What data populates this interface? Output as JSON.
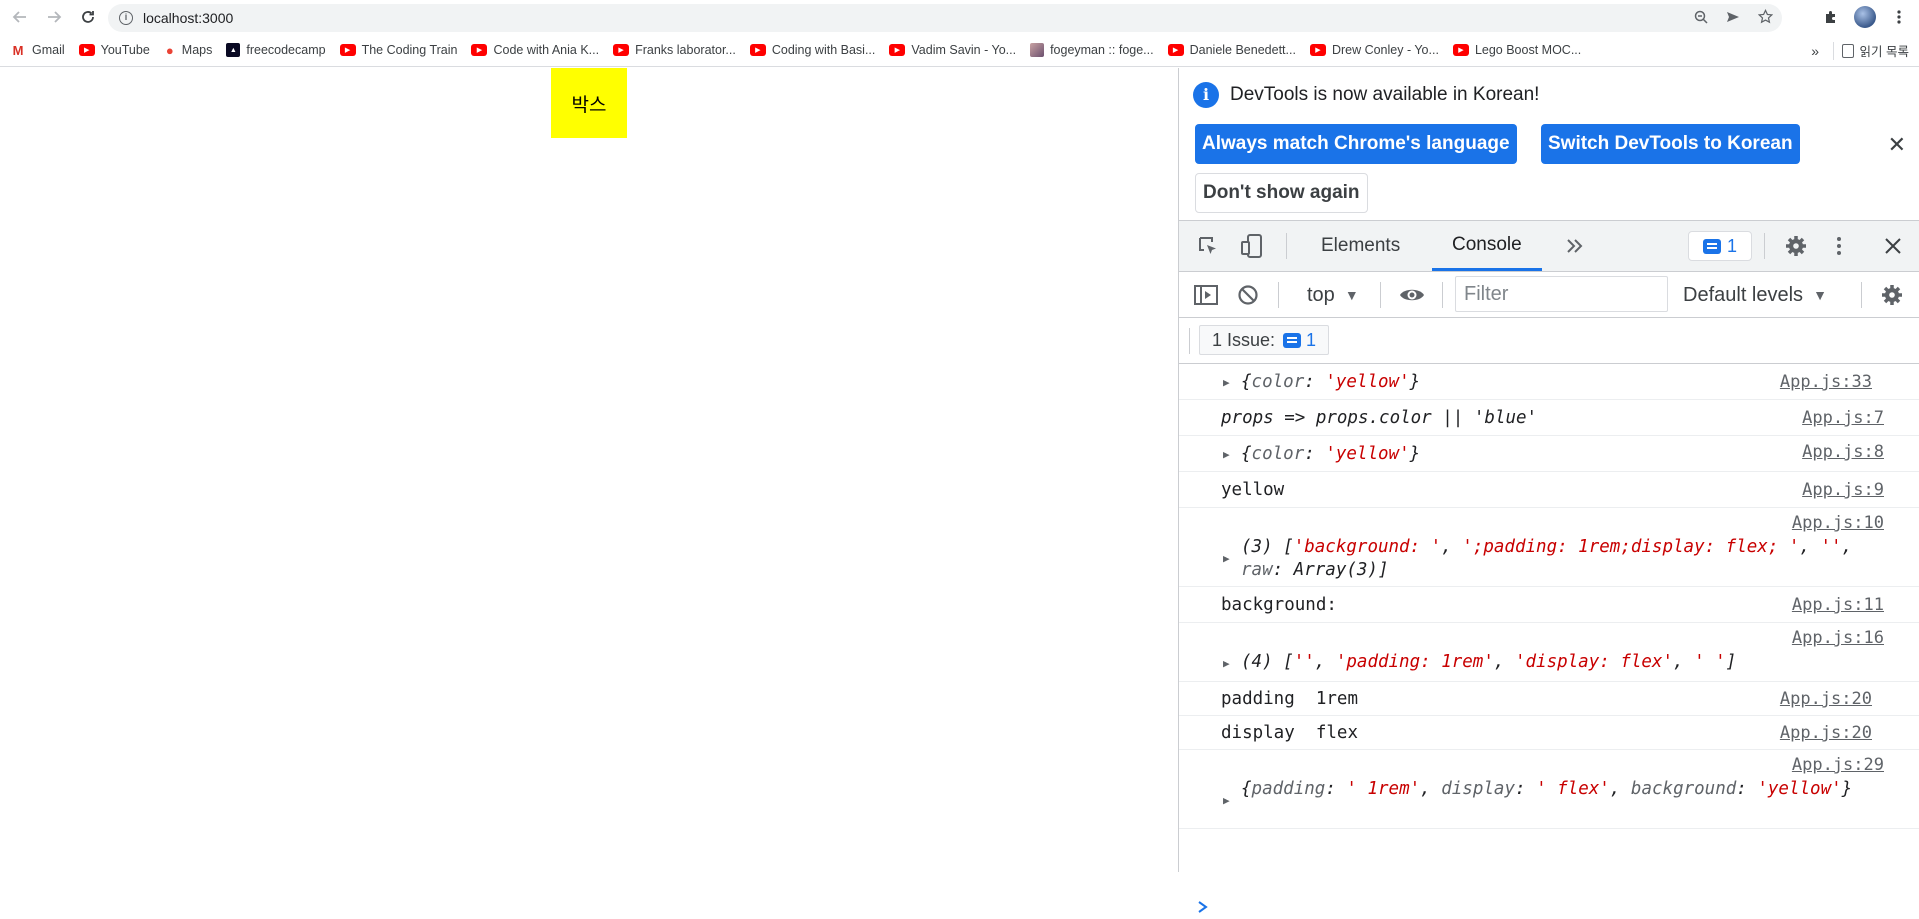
{
  "browser": {
    "url": "localhost:3000",
    "bookmarks": [
      {
        "label": "Gmail",
        "icon": "gmail-icon"
      },
      {
        "label": "YouTube",
        "icon": "youtube-icon"
      },
      {
        "label": "Maps",
        "icon": "maps-icon"
      },
      {
        "label": "freecodecamp",
        "icon": "freecodecamp-icon"
      },
      {
        "label": "The Coding Train",
        "icon": "youtube-icon"
      },
      {
        "label": "Code with Ania K...",
        "icon": "youtube-icon"
      },
      {
        "label": "Franks laborator...",
        "icon": "youtube-icon"
      },
      {
        "label": "Coding with Basi...",
        "icon": "youtube-icon"
      },
      {
        "label": "Vadim Savin - Yo...",
        "icon": "youtube-icon"
      },
      {
        "label": "fogeyman :: foge...",
        "icon": "site-icon"
      },
      {
        "label": "Daniele Benedett...",
        "icon": "youtube-icon"
      },
      {
        "label": "Drew Conley - Yo...",
        "icon": "youtube-icon"
      },
      {
        "label": "Lego Boost MOC...",
        "icon": "youtube-icon"
      }
    ],
    "more_label": "»",
    "reading_list": "읽기 목록"
  },
  "page": {
    "box_label": "박스",
    "box_color": "#ffff00"
  },
  "devtools": {
    "infobar": {
      "message": "DevTools is now available in Korean!",
      "btn_match": "Always match Chrome's language",
      "btn_switch": "Switch DevTools to Korean",
      "btn_dont_show": "Don't show again"
    },
    "tabs": {
      "elements": "Elements",
      "console": "Console",
      "issues_count": "1"
    },
    "console_bar": {
      "context": "top",
      "filter_placeholder": "Filter",
      "levels": "Default levels"
    },
    "issues_bar": {
      "label": "1 Issue:",
      "count": "1"
    },
    "accent_color": "#1a73e8",
    "string_color": "#c80000",
    "rows": {
      "r1_src": "App.js:33",
      "r2_text": "props => props.color || 'blue'",
      "r2_src": "App.js:7",
      "r3_src": "App.js:8",
      "r4_text": "yellow",
      "r4_src": "App.js:9",
      "r5_src": "App.js:10",
      "r6_text": "background: ",
      "r6_src": "App.js:11",
      "r7_src": "App.js:16",
      "r8_key": "padding",
      "r8_val": "1rem",
      "r8_src": "App.js:20",
      "r9_key": "display",
      "r9_val": "flex",
      "r9_src": "App.js:20",
      "r10_src": "App.js:29"
    }
  }
}
